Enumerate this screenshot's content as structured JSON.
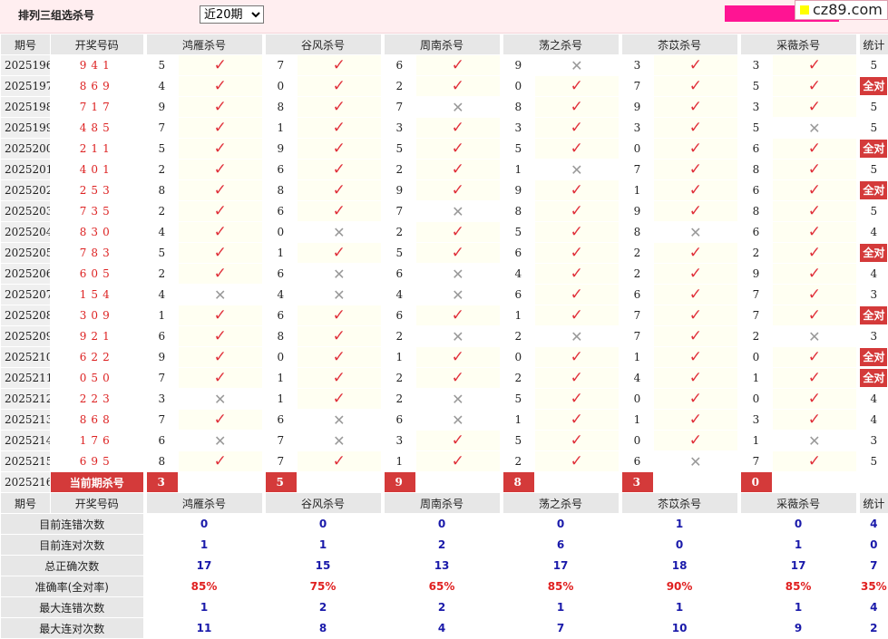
{
  "page": {
    "title": "排列三组选杀号",
    "range_selected": "近20期",
    "range_options": [
      "近20期"
    ],
    "logo_text": "cz89.com",
    "brand_color": "#ff1493",
    "accent_color": "#d43a3a"
  },
  "headers": [
    "期号",
    "开奖号码",
    "鸿雁杀号",
    "谷风杀号",
    "周南杀号",
    "荡之杀号",
    "苶苡杀号",
    "采薇杀号",
    "统计"
  ],
  "rows": [
    {
      "period": "2025196",
      "num": "941",
      "kills": [
        [
          "5",
          1
        ],
        [
          "7",
          1
        ],
        [
          "6",
          1
        ],
        [
          "9",
          0
        ],
        [
          "3",
          1
        ],
        [
          "3",
          1
        ]
      ],
      "stat": "5"
    },
    {
      "period": "2025197",
      "num": "869",
      "kills": [
        [
          "4",
          1
        ],
        [
          "0",
          1
        ],
        [
          "2",
          1
        ],
        [
          "0",
          1
        ],
        [
          "7",
          1
        ],
        [
          "5",
          1
        ]
      ],
      "stat": "全对"
    },
    {
      "period": "2025198",
      "num": "717",
      "kills": [
        [
          "9",
          1
        ],
        [
          "8",
          1
        ],
        [
          "7",
          0
        ],
        [
          "8",
          1
        ],
        [
          "9",
          1
        ],
        [
          "3",
          1
        ]
      ],
      "stat": "5"
    },
    {
      "period": "2025199",
      "num": "485",
      "kills": [
        [
          "7",
          1
        ],
        [
          "1",
          1
        ],
        [
          "3",
          1
        ],
        [
          "3",
          1
        ],
        [
          "3",
          1
        ],
        [
          "5",
          0
        ]
      ],
      "stat": "5"
    },
    {
      "period": "2025200",
      "num": "211",
      "kills": [
        [
          "5",
          1
        ],
        [
          "9",
          1
        ],
        [
          "5",
          1
        ],
        [
          "5",
          1
        ],
        [
          "0",
          1
        ],
        [
          "6",
          1
        ]
      ],
      "stat": "全对"
    },
    {
      "period": "2025201",
      "num": "401",
      "kills": [
        [
          "2",
          1
        ],
        [
          "6",
          1
        ],
        [
          "2",
          1
        ],
        [
          "1",
          0
        ],
        [
          "7",
          1
        ],
        [
          "8",
          1
        ]
      ],
      "stat": "5"
    },
    {
      "period": "2025202",
      "num": "253",
      "kills": [
        [
          "8",
          1
        ],
        [
          "8",
          1
        ],
        [
          "9",
          1
        ],
        [
          "9",
          1
        ],
        [
          "1",
          1
        ],
        [
          "6",
          1
        ]
      ],
      "stat": "全对"
    },
    {
      "period": "2025203",
      "num": "735",
      "kills": [
        [
          "2",
          1
        ],
        [
          "6",
          1
        ],
        [
          "7",
          0
        ],
        [
          "8",
          1
        ],
        [
          "9",
          1
        ],
        [
          "8",
          1
        ]
      ],
      "stat": "5"
    },
    {
      "period": "2025204",
      "num": "830",
      "kills": [
        [
          "4",
          1
        ],
        [
          "0",
          0
        ],
        [
          "2",
          1
        ],
        [
          "5",
          1
        ],
        [
          "8",
          0
        ],
        [
          "6",
          1
        ]
      ],
      "stat": "4"
    },
    {
      "period": "2025205",
      "num": "783",
      "kills": [
        [
          "5",
          1
        ],
        [
          "1",
          1
        ],
        [
          "5",
          1
        ],
        [
          "6",
          1
        ],
        [
          "2",
          1
        ],
        [
          "2",
          1
        ]
      ],
      "stat": "全对"
    },
    {
      "period": "2025206",
      "num": "605",
      "kills": [
        [
          "2",
          1
        ],
        [
          "6",
          0
        ],
        [
          "6",
          0
        ],
        [
          "4",
          1
        ],
        [
          "2",
          1
        ],
        [
          "9",
          1
        ]
      ],
      "stat": "4"
    },
    {
      "period": "2025207",
      "num": "154",
      "kills": [
        [
          "4",
          0
        ],
        [
          "4",
          0
        ],
        [
          "4",
          0
        ],
        [
          "6",
          1
        ],
        [
          "6",
          1
        ],
        [
          "7",
          1
        ]
      ],
      "stat": "3"
    },
    {
      "period": "2025208",
      "num": "309",
      "kills": [
        [
          "1",
          1
        ],
        [
          "6",
          1
        ],
        [
          "6",
          1
        ],
        [
          "1",
          1
        ],
        [
          "7",
          1
        ],
        [
          "7",
          1
        ]
      ],
      "stat": "全对"
    },
    {
      "period": "2025209",
      "num": "921",
      "kills": [
        [
          "6",
          1
        ],
        [
          "8",
          1
        ],
        [
          "2",
          0
        ],
        [
          "2",
          0
        ],
        [
          "7",
          1
        ],
        [
          "2",
          0
        ]
      ],
      "stat": "3"
    },
    {
      "period": "2025210",
      "num": "622",
      "kills": [
        [
          "9",
          1
        ],
        [
          "0",
          1
        ],
        [
          "1",
          1
        ],
        [
          "0",
          1
        ],
        [
          "1",
          1
        ],
        [
          "0",
          1
        ]
      ],
      "stat": "全对"
    },
    {
      "period": "2025211",
      "num": "050",
      "kills": [
        [
          "7",
          1
        ],
        [
          "1",
          1
        ],
        [
          "2",
          1
        ],
        [
          "2",
          1
        ],
        [
          "4",
          1
        ],
        [
          "1",
          1
        ]
      ],
      "stat": "全对"
    },
    {
      "period": "2025212",
      "num": "223",
      "kills": [
        [
          "3",
          0
        ],
        [
          "1",
          1
        ],
        [
          "2",
          0
        ],
        [
          "5",
          1
        ],
        [
          "0",
          1
        ],
        [
          "0",
          1
        ]
      ],
      "stat": "4"
    },
    {
      "period": "2025213",
      "num": "868",
      "kills": [
        [
          "7",
          1
        ],
        [
          "6",
          0
        ],
        [
          "6",
          0
        ],
        [
          "1",
          1
        ],
        [
          "1",
          1
        ],
        [
          "3",
          1
        ]
      ],
      "stat": "4"
    },
    {
      "period": "2025214",
      "num": "176",
      "kills": [
        [
          "6",
          0
        ],
        [
          "7",
          0
        ],
        [
          "3",
          1
        ],
        [
          "5",
          1
        ],
        [
          "0",
          1
        ],
        [
          "1",
          0
        ]
      ],
      "stat": "3"
    },
    {
      "period": "2025215",
      "num": "695",
      "kills": [
        [
          "8",
          1
        ],
        [
          "7",
          1
        ],
        [
          "1",
          1
        ],
        [
          "2",
          1
        ],
        [
          "6",
          0
        ],
        [
          "7",
          1
        ]
      ],
      "stat": "5"
    }
  ],
  "current": {
    "period": "2025216",
    "label": "当前期杀号",
    "kills": [
      "3",
      "5",
      "9",
      "8",
      "3",
      "0"
    ]
  },
  "summary": {
    "head": [
      "期号",
      "开奖号码",
      "鸿雁杀号",
      "谷风杀号",
      "周南杀号",
      "荡之杀号",
      "苶苡杀号",
      "采薇杀号",
      "统计"
    ],
    "rows": [
      {
        "label": "目前连错次数",
        "values": [
          "0",
          "0",
          "0",
          "0",
          "1",
          "0",
          "4"
        ],
        "red": false
      },
      {
        "label": "目前连对次数",
        "values": [
          "1",
          "1",
          "2",
          "6",
          "0",
          "1",
          "0"
        ],
        "red": false
      },
      {
        "label": "总正确次数",
        "values": [
          "17",
          "15",
          "13",
          "17",
          "18",
          "17",
          "7"
        ],
        "red": false
      },
      {
        "label": "准确率(全对率)",
        "values": [
          "85%",
          "75%",
          "65%",
          "85%",
          "90%",
          "85%",
          "35%"
        ],
        "red": true
      },
      {
        "label": "最大连错次数",
        "values": [
          "1",
          "2",
          "2",
          "1",
          "1",
          "1",
          "4"
        ],
        "red": false
      },
      {
        "label": "最大连对次数",
        "values": [
          "11",
          "8",
          "4",
          "7",
          "10",
          "9",
          "2"
        ],
        "red": false
      }
    ]
  }
}
